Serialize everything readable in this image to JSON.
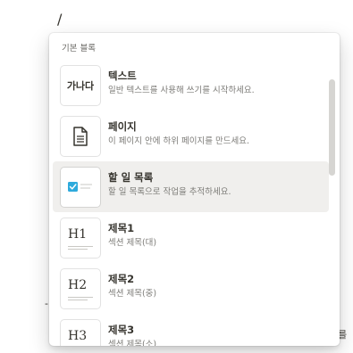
{
  "editor": {
    "slash_char": "/",
    "bg_left_char": "-",
    "bg_right_char": "를"
  },
  "menu": {
    "section_title": "기본 블록",
    "items": [
      {
        "key": "text",
        "title": "텍스트",
        "description": "일반 텍스트를 사용해 쓰기를 시작하세요.",
        "thumb_text": "가나다",
        "icon": "text-thumbnail",
        "active": false
      },
      {
        "key": "page",
        "title": "페이지",
        "description": "이 페이지 안에 하위 페이지를 만드세요.",
        "icon": "document-icon",
        "active": false
      },
      {
        "key": "todo",
        "title": "할 일 목록",
        "description": "할 일 목록으로 작업을 추적하세요.",
        "icon": "checkbox-icon",
        "active": true
      },
      {
        "key": "h1",
        "title": "제목1",
        "description": "섹션 제목(대)",
        "thumb_text": "H1",
        "icon": "heading1-icon",
        "active": false
      },
      {
        "key": "h2",
        "title": "제목2",
        "description": "섹션 제목(중)",
        "thumb_text": "H2",
        "icon": "heading2-icon",
        "active": false
      },
      {
        "key": "h3",
        "title": "제목3",
        "description": "섹션 제목(소)",
        "thumb_text": "H3",
        "icon": "heading3-icon",
        "active": false
      }
    ],
    "colors": {
      "active_bg": "#f0efed",
      "checkbox_blue": "#2eaadc",
      "text": "#37352f",
      "muted": "#7c7b77"
    }
  }
}
